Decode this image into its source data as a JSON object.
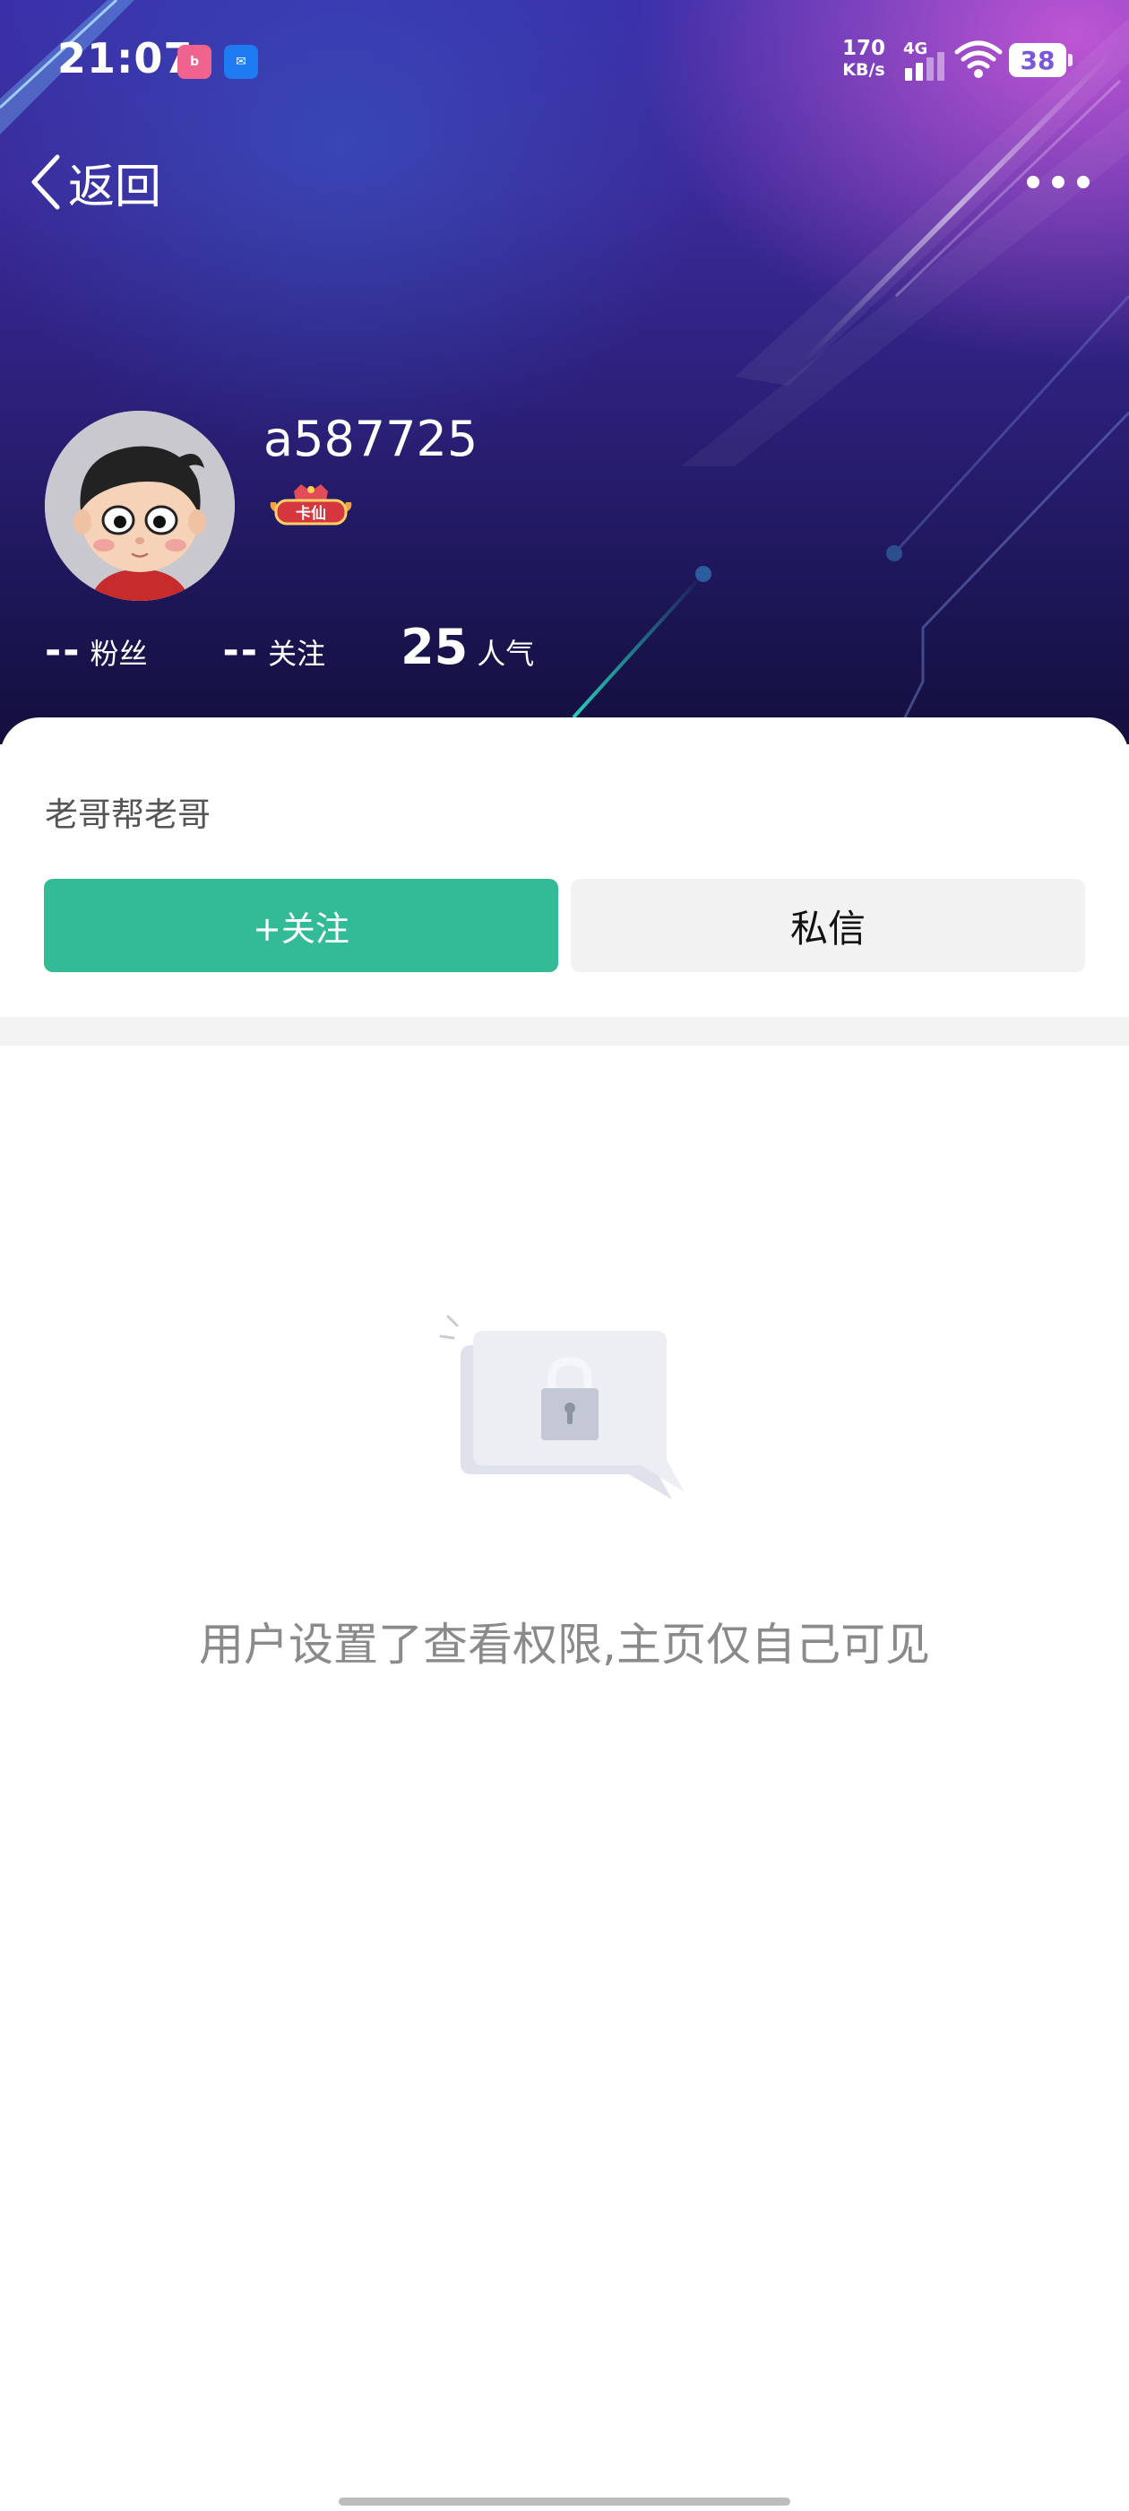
{
  "status_bar": {
    "time": "21:07",
    "net_speed_value": "170",
    "net_speed_unit": "KB/s",
    "network_type": "4G",
    "battery": "38",
    "app_icons": [
      "bilibili-app-icon",
      "message-app-icon"
    ]
  },
  "nav": {
    "back_label": "返回",
    "more_icon": "more-dots-icon"
  },
  "profile": {
    "username": "a587725",
    "badge_text": "卡仙",
    "stats": [
      {
        "value": "--",
        "label": "粉丝"
      },
      {
        "value": "--",
        "label": "关注"
      },
      {
        "value": "25",
        "label": "人气"
      }
    ],
    "signature": "老哥帮老哥"
  },
  "actions": {
    "follow_label": "+关注",
    "message_label": "私信"
  },
  "empty_state": {
    "icon": "lock-icon",
    "text": "用户设置了查看权限,主页仅自己可见"
  },
  "colors": {
    "follow_button": "#33bb98",
    "message_button": "#f2f2f2",
    "header_gradient_top": "#3a2fa8",
    "header_gradient_bottom": "#140f3d",
    "accent_pink": "#d65cdc"
  }
}
